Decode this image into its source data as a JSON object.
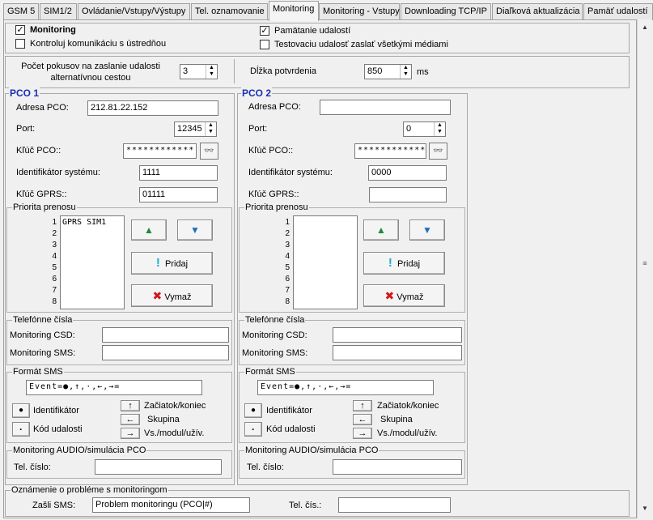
{
  "tabs": [
    "GSM 5",
    "SIM1/2",
    "Ovládanie/Vstupy/Výstupy",
    "Tel. oznamovanie",
    "Monitoring",
    "Monitoring - Vstupy",
    "Downloading TCP/IP",
    "Diaľková aktualizácia",
    "Pamäť udalostí"
  ],
  "active_tab": "Monitoring",
  "top": {
    "monitoring_label": "Monitoring",
    "monitoring_checked": true,
    "kontroluj_label": "Kontroluj komunikáciu s ústredňou",
    "kontroluj_checked": false,
    "pamatanie_label": "Pamätanie udalostí",
    "pamatanie_checked": true,
    "testovaciu_label": "Testovaciu udalosť zaslať všetkými médiami",
    "testovaciu_checked": false
  },
  "attempts": {
    "label_line1": "Počet pokusov na zaslanie udalosti",
    "label_line2": "alternatívnou cestou",
    "value": "3",
    "confirm_label": "Dĺžka potvrdenia",
    "confirm_value": "850",
    "confirm_unit": "ms"
  },
  "pco1": {
    "title": "PCO 1",
    "address_label": "Adresa PCO:",
    "address_value": "212.81.22.152",
    "port_label": "Port:",
    "port_value": "12345",
    "key_label": "Kľúč PCO::",
    "key_value": "************",
    "sysid_label": "Identifikátor systému:",
    "sysid_value": "1111",
    "gprs_label": "Kľúč GPRS::",
    "gprs_value": "01111",
    "priority_title": "Priorita prenosu",
    "priority_items": [
      "GPRS SIM1"
    ],
    "add_label": "Pridaj",
    "delete_label": "Vymaž",
    "phones_title": "Telefónne čísla",
    "csd_label": "Monitoring CSD:",
    "csd_value": "",
    "sms_label": "Monitoring SMS:",
    "sms_value": "",
    "format_title": "Formát SMS",
    "format_value": "Event=●,↑,·,←,→=",
    "identifikator_label": "Identifikátor",
    "kod_label": "Kód udalosti",
    "zaciatok_label": "Začiatok/koniec",
    "skupina_label": "Skupina",
    "vs_label": "Vs./modul/užív.",
    "audio_title": "Monitoring AUDIO/simulácia PCO",
    "tel_label": "Tel. číslo:",
    "tel_value": ""
  },
  "pco2": {
    "title": "PCO 2",
    "address_label": "Adresa PCO:",
    "address_value": "",
    "port_label": "Port:",
    "port_value": "0",
    "key_label": "Kľúč PCO::",
    "key_value": "************",
    "sysid_label": "Identifikátor systému:",
    "sysid_value": "0000",
    "gprs_label": "Kľúč GPRS::",
    "gprs_value": "",
    "priority_title": "Priorita prenosu",
    "priority_items": [],
    "add_label": "Pridaj",
    "delete_label": "Vymaž",
    "phones_title": "Telefónne čísla",
    "csd_label": "Monitoring CSD:",
    "csd_value": "",
    "sms_label": "Monitoring SMS:",
    "sms_value": "",
    "format_title": "Formát SMS",
    "format_value": "Event=●,↑,·,←,→=",
    "identifikator_label": "Identifikátor",
    "kod_label": "Kód udalosti",
    "zaciatok_label": "Začiatok/koniec",
    "skupina_label": "Skupina",
    "vs_label": "Vs./modul/užív.",
    "audio_title": "Monitoring AUDIO/simulácia PCO",
    "tel_label": "Tel. číslo:",
    "tel_value": ""
  },
  "priority_numbers": [
    "1",
    "2",
    "3",
    "4",
    "5",
    "6",
    "7",
    "8"
  ],
  "problem": {
    "title": "Oznámenie o probléme s monitoringom",
    "sms_label": "Zašli SMS:",
    "sms_value": "Problem monitoringu (PCO|#)",
    "tel_label": "Tel. čís.:",
    "tel_value": ""
  },
  "colors": {
    "pco_title": "#1a2fb5",
    "up_arrow": "#1f8a3a",
    "down_arrow": "#1f6fb8",
    "add_icon": "#1fa9d6",
    "delete_icon": "#cc1a1a"
  },
  "icons": {
    "up": "▲",
    "down": "▼",
    "eye": "👓",
    "add": "!",
    "delete": "✖",
    "dot": "●",
    "middot": "·",
    "arrow_up": "↑",
    "arrow_left": "←",
    "arrow_right": "→",
    "check": "✓"
  }
}
